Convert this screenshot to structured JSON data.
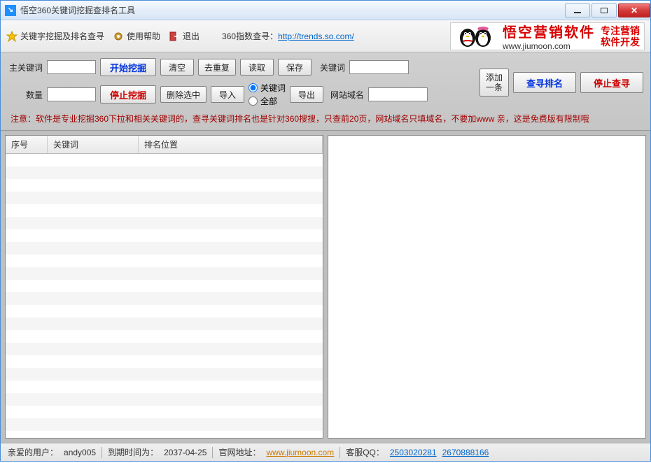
{
  "title": "悟空360关键词挖掘查排名工具",
  "toolbar": {
    "mining": "关键字挖掘及排名查寻",
    "help": "使用帮助",
    "exit": "退出",
    "indexLabel": "360指数查寻：",
    "indexUrl": "http://trends.so.com/"
  },
  "banner": {
    "brand": "悟空营销软件",
    "url": "www.jiumoon.com",
    "slogan1": "专注营销",
    "slogan2": "软件开发"
  },
  "ctrl": {
    "mainKw": "主关键词",
    "start": "开始挖掘",
    "clear": "清空",
    "dedupe": "去重复",
    "read": "读取",
    "save": "保存",
    "keyword": "关键词",
    "quantity": "数量",
    "stop": "停止挖掘",
    "delSel": "删除选中",
    "import": "导入",
    "export": "导出",
    "radioKeyword": "关键词",
    "radioAll": "全部",
    "domain": "网站域名",
    "addOne": "添加\n一条",
    "searchRank": "查寻排名",
    "stopSearch": "停止查寻"
  },
  "notice": "注意：软件是专业挖掘360下拉和相关关键词的，查寻关键词排名也是针对360搜搜，只查前20页，网站域名只填域名，不要加www      亲，这是免费版有限制哦",
  "table": {
    "col1": "序号",
    "col2": "关键词",
    "col3": "排名位置"
  },
  "status": {
    "userLabel": "亲爱的用户：",
    "user": "andy005",
    "expireLabel": "到期时间为：",
    "expire": "2037-04-25",
    "siteLabel": "官网地址：",
    "site": "www.jiumoon.com",
    "qqLabel": "客服QQ：",
    "qq1": "2503020281",
    "qq2": "2670888166"
  }
}
